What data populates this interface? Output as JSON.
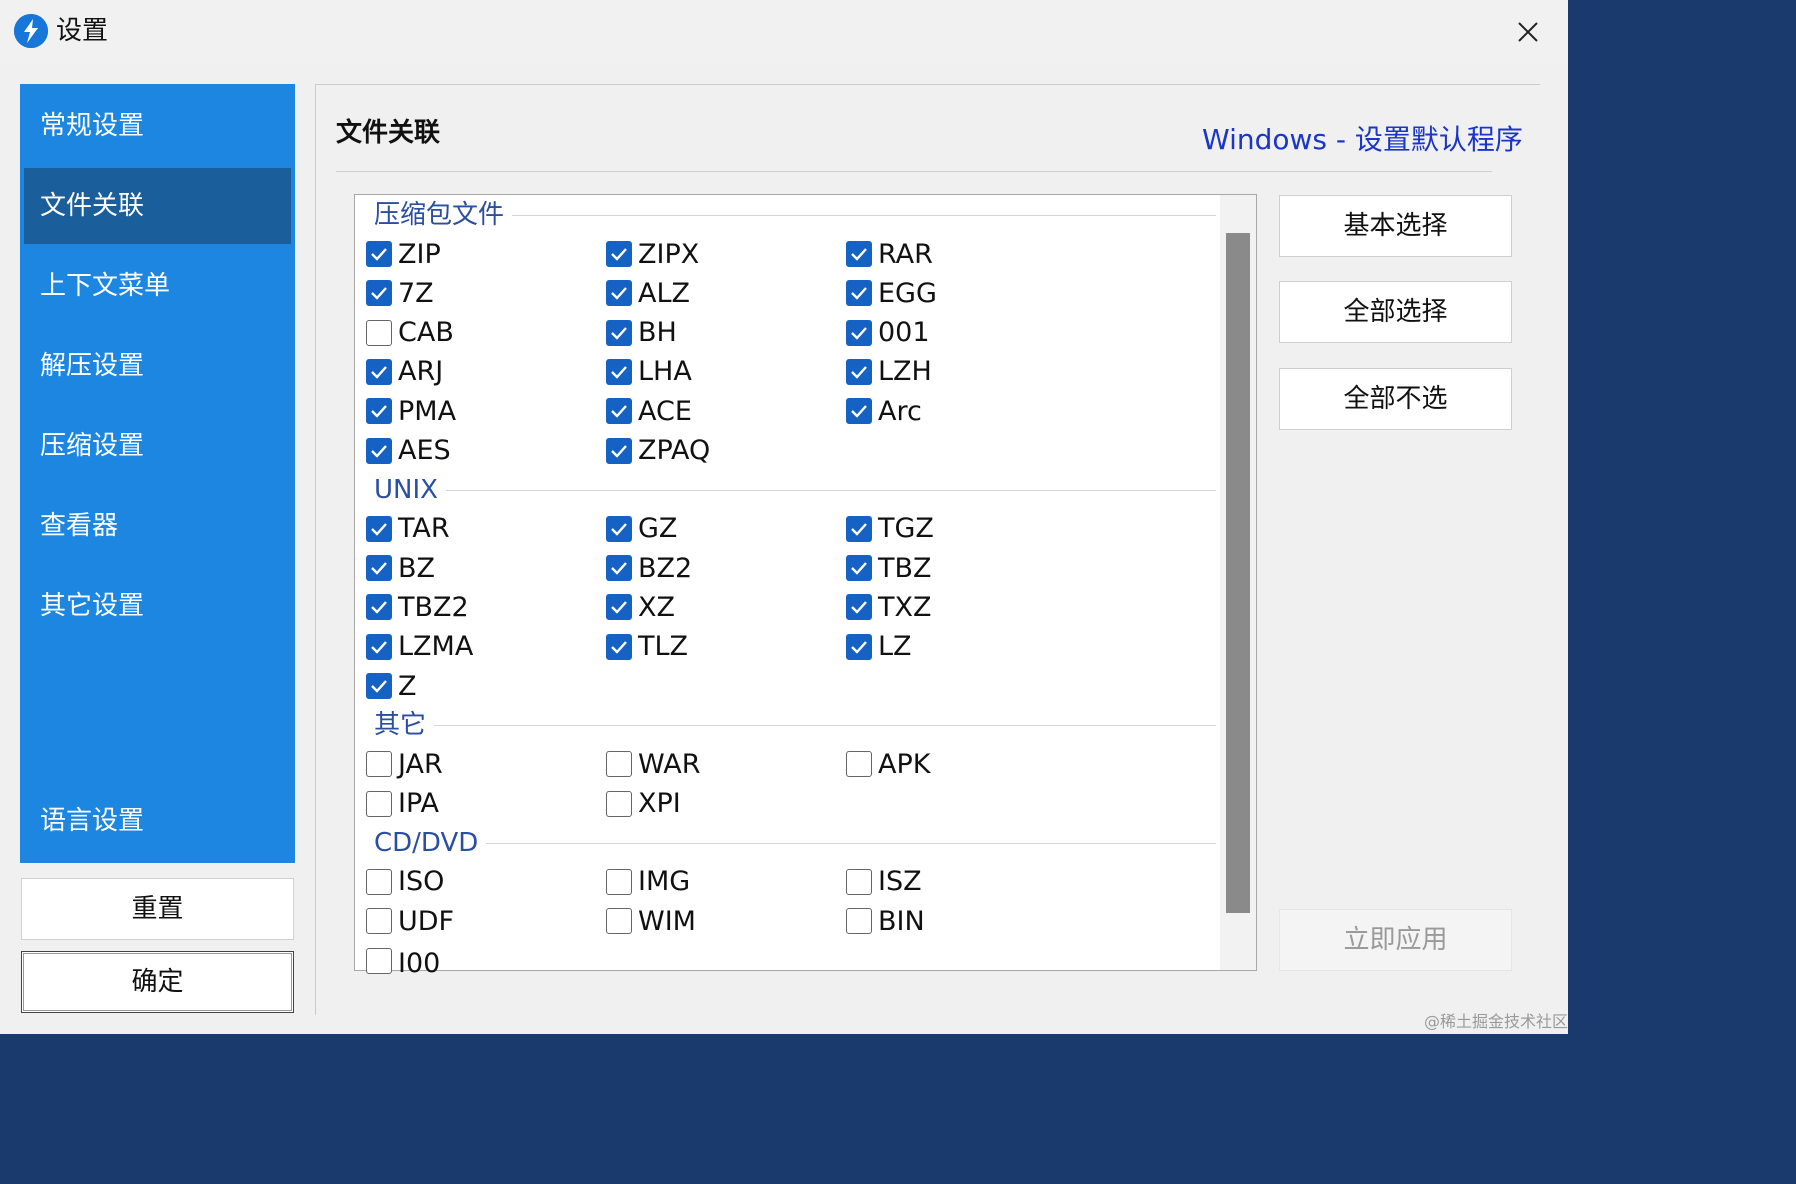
{
  "window": {
    "title": "设置",
    "app_icon": "app-logo-icon",
    "close_icon": "close-icon"
  },
  "sidebar": {
    "items": [
      {
        "label": "常规设置",
        "active": false
      },
      {
        "label": "文件关联",
        "active": true
      },
      {
        "label": "上下文菜单",
        "active": false
      },
      {
        "label": "解压设置",
        "active": false
      },
      {
        "label": "压缩设置",
        "active": false
      },
      {
        "label": "查看器",
        "active": false
      },
      {
        "label": "其它设置",
        "active": false
      },
      {
        "label": "语言设置",
        "active": false
      }
    ],
    "reset_label": "重置",
    "ok_label": "确定"
  },
  "main": {
    "title": "文件关联",
    "link": "Windows - 设置默认程序",
    "groups": [
      {
        "name": "压缩包文件",
        "items": [
          {
            "label": "ZIP",
            "checked": true
          },
          {
            "label": "ZIPX",
            "checked": true
          },
          {
            "label": "RAR",
            "checked": true
          },
          {
            "label": "7Z",
            "checked": true
          },
          {
            "label": "ALZ",
            "checked": true
          },
          {
            "label": "EGG",
            "checked": true
          },
          {
            "label": "CAB",
            "checked": false
          },
          {
            "label": "BH",
            "checked": true
          },
          {
            "label": "001",
            "checked": true
          },
          {
            "label": "ARJ",
            "checked": true
          },
          {
            "label": "LHA",
            "checked": true
          },
          {
            "label": "LZH",
            "checked": true
          },
          {
            "label": "PMA",
            "checked": true
          },
          {
            "label": "ACE",
            "checked": true
          },
          {
            "label": "Arc",
            "checked": true
          },
          {
            "label": "AES",
            "checked": true
          },
          {
            "label": "ZPAQ",
            "checked": true
          }
        ]
      },
      {
        "name": "UNIX",
        "items": [
          {
            "label": "TAR",
            "checked": true
          },
          {
            "label": "GZ",
            "checked": true
          },
          {
            "label": "TGZ",
            "checked": true
          },
          {
            "label": "BZ",
            "checked": true
          },
          {
            "label": "BZ2",
            "checked": true
          },
          {
            "label": "TBZ",
            "checked": true
          },
          {
            "label": "TBZ2",
            "checked": true
          },
          {
            "label": "XZ",
            "checked": true
          },
          {
            "label": "TXZ",
            "checked": true
          },
          {
            "label": "LZMA",
            "checked": true
          },
          {
            "label": "TLZ",
            "checked": true
          },
          {
            "label": "LZ",
            "checked": true
          },
          {
            "label": "Z",
            "checked": true
          }
        ]
      },
      {
        "name": "其它",
        "items": [
          {
            "label": "JAR",
            "checked": false
          },
          {
            "label": "WAR",
            "checked": false
          },
          {
            "label": "APK",
            "checked": false
          },
          {
            "label": "IPA",
            "checked": false
          },
          {
            "label": "XPI",
            "checked": false
          }
        ]
      },
      {
        "name": "CD/DVD",
        "items": [
          {
            "label": "ISO",
            "checked": false
          },
          {
            "label": "IMG",
            "checked": false
          },
          {
            "label": "ISZ",
            "checked": false
          },
          {
            "label": "UDF",
            "checked": false
          },
          {
            "label": "WIM",
            "checked": false
          },
          {
            "label": "BIN",
            "checked": false
          },
          {
            "label": "I00",
            "checked": false
          }
        ]
      }
    ],
    "buttons": {
      "basic": "基本选择",
      "select_all": "全部选择",
      "select_none": "全部不选"
    },
    "apply_label": "立即应用"
  },
  "watermark": "@稀土掘金技术社区",
  "colors": {
    "accent": "#1c86e0",
    "active_nav": "#1a5e9c",
    "checkbox": "#1562c4",
    "link": "#1a35c8"
  }
}
